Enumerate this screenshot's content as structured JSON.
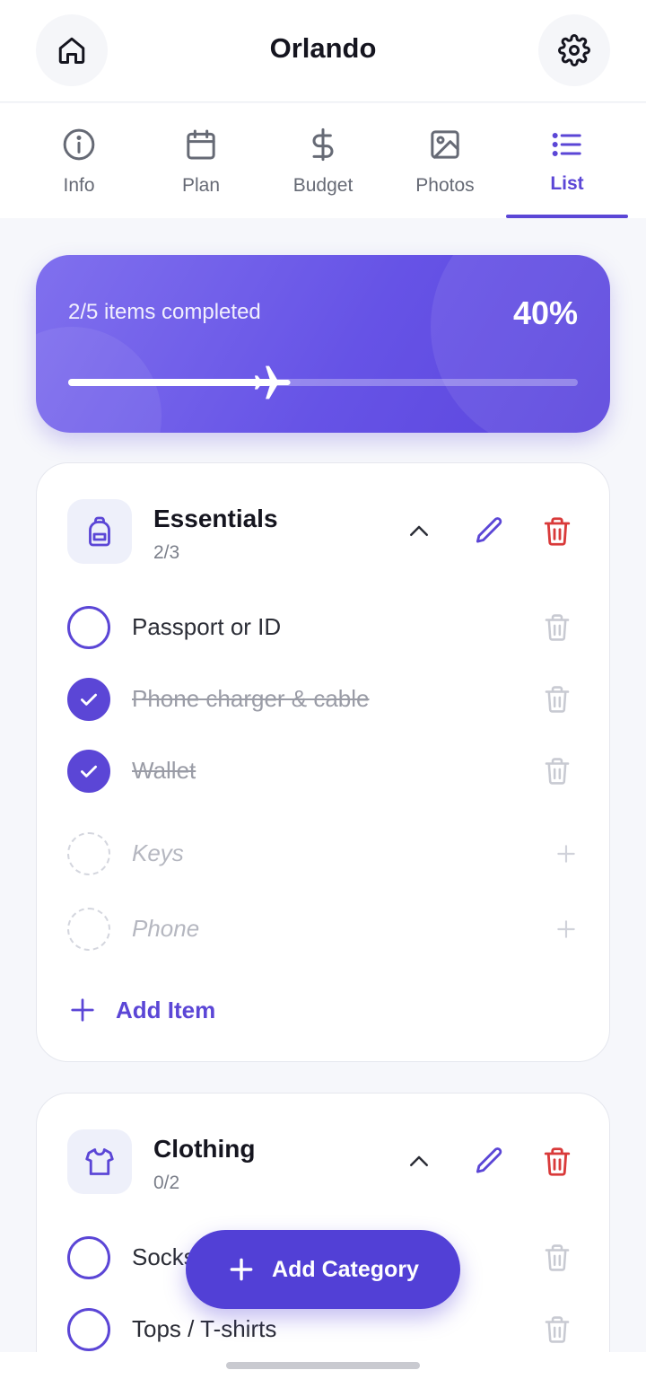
{
  "header": {
    "title": "Orlando",
    "home_icon": "home-icon",
    "settings_icon": "gear-icon"
  },
  "tabs": [
    {
      "label": "Info",
      "icon": "info-icon",
      "active": false
    },
    {
      "label": "Plan",
      "icon": "calendar-icon",
      "active": false
    },
    {
      "label": "Budget",
      "icon": "dollar-icon",
      "active": false
    },
    {
      "label": "Photos",
      "icon": "image-icon",
      "active": false
    },
    {
      "label": "List",
      "icon": "list-icon",
      "active": true
    }
  ],
  "progress": {
    "text": "2/5 items completed",
    "percent_label": "40%",
    "fraction": 0.4
  },
  "categories": [
    {
      "name": "Essentials",
      "count": "2/3",
      "icon": "backpack-icon",
      "items": [
        {
          "label": "Passport or ID",
          "checked": false
        },
        {
          "label": "Phone charger & cable",
          "checked": true
        },
        {
          "label": "Wallet",
          "checked": true
        }
      ],
      "suggestions": [
        {
          "label": "Keys"
        },
        {
          "label": "Phone"
        }
      ],
      "add_item_label": "Add Item"
    },
    {
      "name": "Clothing",
      "count": "0/2",
      "icon": "shirt-icon",
      "items": [
        {
          "label": "Socks",
          "checked": false
        },
        {
          "label": "Tops / T-shirts",
          "checked": false
        }
      ]
    }
  ],
  "fab": {
    "label": "Add Category"
  },
  "colors": {
    "accent": "#5b46d6",
    "danger": "#d93a3a",
    "muted_icon": "#c8cad2"
  }
}
